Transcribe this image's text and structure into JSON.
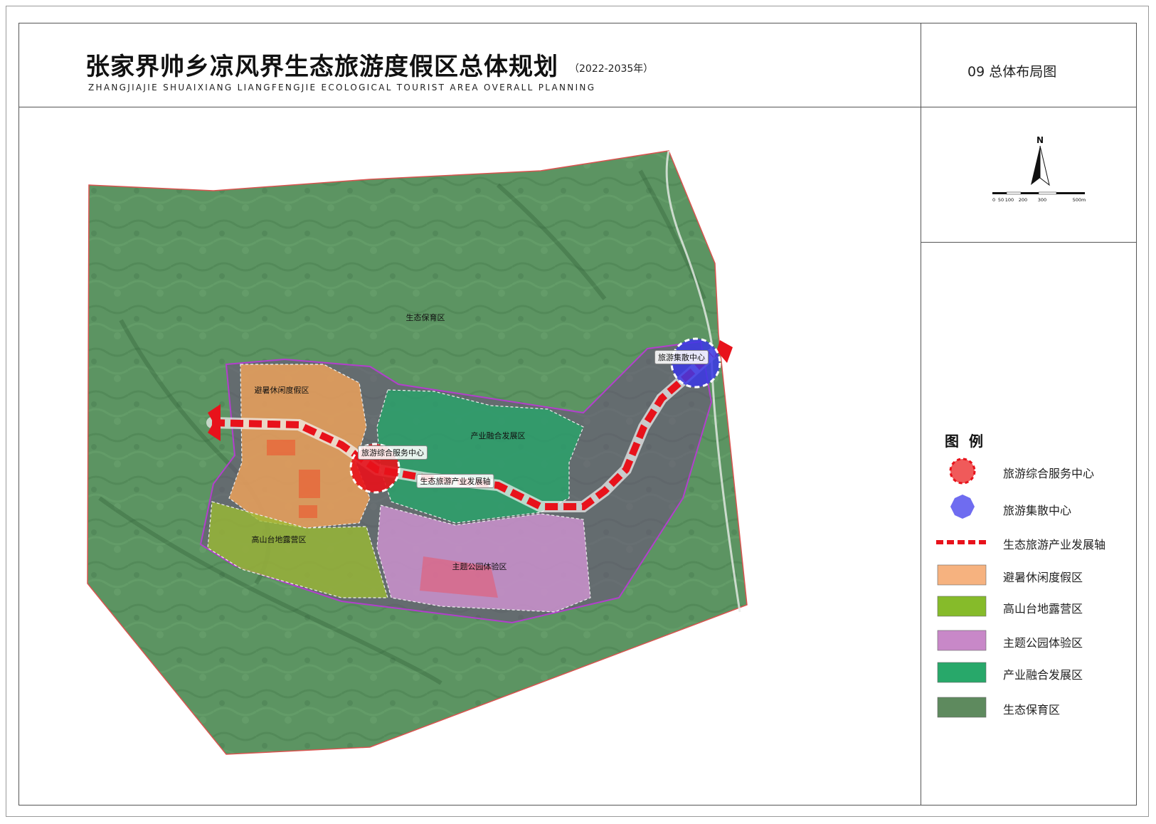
{
  "header": {
    "title": "张家界帅乡凉风界生态旅游度假区总体规划",
    "years": "（2022-2035年）",
    "subtitle": "ZHANGJIAJIE SHUAIXIANG LIANGFENGJIE ECOLOGICAL TOURIST AREA OVERALL PLANNING",
    "sheet": "09  总体布局图"
  },
  "compass": {
    "north": "N",
    "scale_ticks": [
      "0",
      "50",
      "100",
      "200",
      "300",
      "500m"
    ]
  },
  "map_labels": {
    "eco": "生态保育区",
    "resort": "避暑休闲度假区",
    "industry": "产业融合发展区",
    "camp": "高山台地露营区",
    "theme": "主题公园体验区",
    "service_center": "旅游综合服务中心",
    "dispersal_center": "旅游集散中心",
    "axis": "生态旅游产业发展轴"
  },
  "legend": {
    "title": "图例",
    "items": [
      {
        "label": "旅游综合服务中心",
        "color": "#f05a5a"
      },
      {
        "label": "旅游集散中心",
        "color": "#6f6cf0"
      },
      {
        "label": "生态旅游产业发展轴",
        "color": "#e8121b"
      },
      {
        "label": "避暑休闲度假区",
        "color": "#f6b27f"
      },
      {
        "label": "高山台地露营区",
        "color": "#86bb2a"
      },
      {
        "label": "主题公园体验区",
        "color": "#c888c8"
      },
      {
        "label": "产业融合发展区",
        "color": "#28a86a"
      },
      {
        "label": "生态保育区",
        "color": "#5e8a5e"
      }
    ]
  }
}
